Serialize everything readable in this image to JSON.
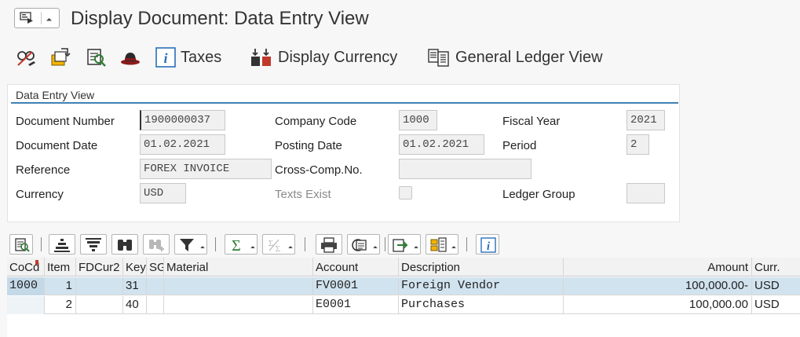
{
  "window": {
    "title": "Display Document: Data Entry View"
  },
  "toolbar": {
    "taxes_label": "Taxes",
    "display_currency_label": "Display Currency",
    "general_ledger_view_label": "General Ledger View"
  },
  "header": {
    "group_title": "Data Entry View",
    "document_number": {
      "label": "Document Number",
      "value": "1900000037"
    },
    "company_code": {
      "label": "Company Code",
      "value": "1000"
    },
    "fiscal_year": {
      "label": "Fiscal Year",
      "value": "2021"
    },
    "document_date": {
      "label": "Document Date",
      "value": "01.02.2021"
    },
    "posting_date": {
      "label": "Posting Date",
      "value": "01.02.2021"
    },
    "period": {
      "label": "Period",
      "value": "2"
    },
    "reference": {
      "label": "Reference",
      "value": "FOREX INVOICE"
    },
    "cross_comp_no": {
      "label": "Cross-Comp.No.",
      "value": ""
    },
    "currency": {
      "label": "Currency",
      "value": "USD"
    },
    "texts_exist": {
      "label": "Texts Exist",
      "checked": false
    },
    "ledger_group": {
      "label": "Ledger Group",
      "value": ""
    }
  },
  "grid": {
    "columns": [
      "CoCd",
      "Item",
      "FDCur2",
      "Key",
      "SG",
      "Material",
      "Account",
      "Description",
      "Amount",
      "Curr."
    ],
    "rows": [
      {
        "cocd": "1000",
        "item": "1",
        "fdcur2": "",
        "key": "31",
        "sg": "",
        "material": "",
        "account": "FV0001",
        "description": "Foreign Vendor",
        "amount": "100,000.00-",
        "curr": "USD",
        "selected": true
      },
      {
        "cocd": "",
        "item": "2",
        "fdcur2": "",
        "key": "40",
        "sg": "",
        "material": "",
        "account": "E0001",
        "description": "Purchases",
        "amount": "100,000.00",
        "curr": "USD",
        "selected": false
      }
    ]
  },
  "icons": [
    "menu-icon",
    "display-icon",
    "switch-document-icon",
    "overview-icon",
    "hat-icon",
    "info-icon",
    "currency-icon",
    "general-ledger-icon",
    "details-icon",
    "sort-ascending-icon",
    "sort-descending-icon",
    "find-icon",
    "find-next-icon",
    "filter-icon",
    "sum-icon",
    "subtotal-icon",
    "print-icon",
    "layout-icon",
    "export-icon",
    "change-layout-icon",
    "information-icon"
  ]
}
